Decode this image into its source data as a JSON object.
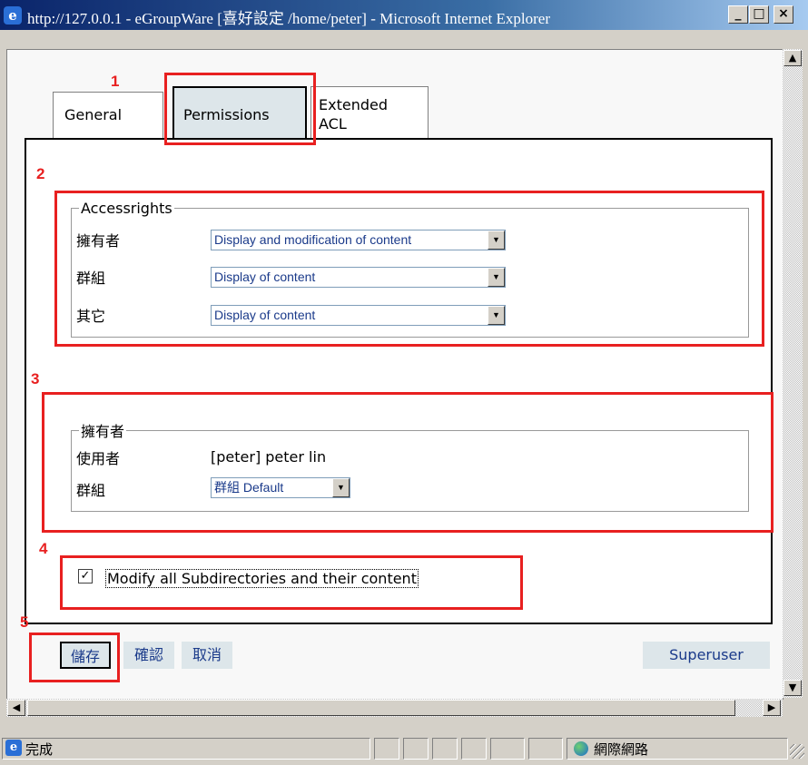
{
  "window": {
    "title": "http://127.0.0.1 - eGroupWare [喜好設定 /home/peter] - Microsoft Internet Explorer",
    "minimize": "_",
    "maximize": "□",
    "close": "×"
  },
  "tabs": [
    {
      "label": "General"
    },
    {
      "label": "Permissions"
    },
    {
      "label_line1": "Extended",
      "label_line2": "ACL"
    }
  ],
  "accessrights": {
    "legend": "Accessrights",
    "rows": [
      {
        "label": "擁有者",
        "value": "Display and modification of content"
      },
      {
        "label": "群組",
        "value": "Display of content"
      },
      {
        "label": "其它",
        "value": "Display of content"
      }
    ]
  },
  "owner": {
    "legend": "擁有者",
    "user_label": "使用者",
    "user_value": "[peter] peter lin",
    "group_label": "群組",
    "group_value": "群組 Default"
  },
  "modify_subdirs": {
    "label": "Modify all Subdirectories and their content",
    "checked": true
  },
  "buttons": {
    "save": "儲存",
    "confirm": "確認",
    "cancel": "取消",
    "superuser": "Superuser"
  },
  "annotations": [
    "1",
    "2",
    "3",
    "4",
    "5"
  ],
  "status": {
    "text": "完成",
    "zone": "網際網路"
  },
  "colors": {
    "annotation": "#e82020",
    "titlebar": "#0a246a",
    "tab_active": "#dde6ea"
  }
}
